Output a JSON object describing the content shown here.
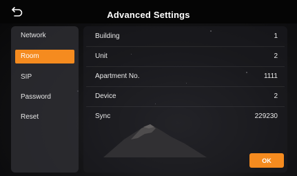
{
  "header": {
    "title": "Advanced Settings",
    "back_icon": "back-arrow-icon"
  },
  "sidebar": {
    "items": [
      {
        "label": "Network",
        "active": false
      },
      {
        "label": "Room",
        "active": true
      },
      {
        "label": "SIP",
        "active": false
      },
      {
        "label": "Password",
        "active": false
      },
      {
        "label": "Reset",
        "active": false
      }
    ]
  },
  "room": {
    "rows": [
      {
        "label": "Building",
        "value": "1"
      },
      {
        "label": "Unit",
        "value": "2"
      },
      {
        "label": "Apartment No.",
        "value": "1111"
      },
      {
        "label": "Device",
        "value": "2"
      },
      {
        "label": "Sync",
        "value": "229230"
      }
    ]
  },
  "actions": {
    "ok_label": "OK"
  },
  "colors": {
    "accent": "#f58b1f",
    "background": "#0b0b0d"
  }
}
